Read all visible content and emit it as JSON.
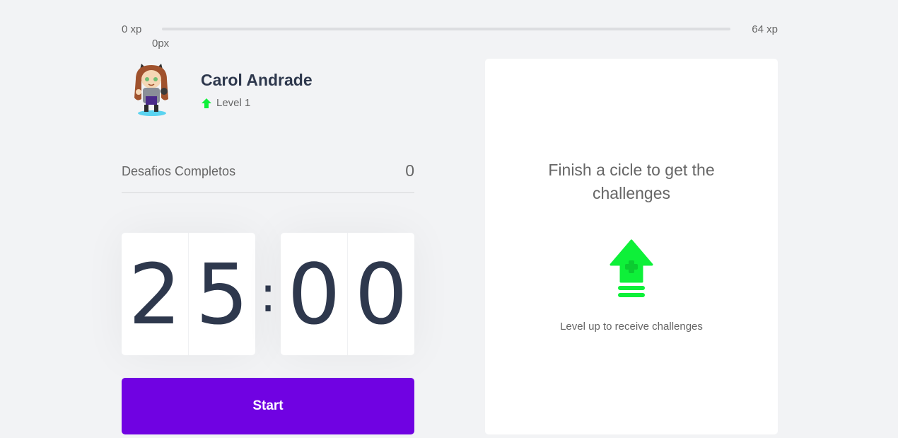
{
  "experience": {
    "min_label": "0 xp",
    "max_label": "64 xp",
    "current_label": "0px",
    "progress": 0
  },
  "profile": {
    "name": "Carol Andrade",
    "level_label": "Level 1",
    "avatar_icon": "avatar-character-icon",
    "level_icon": "level-up-arrow-icon"
  },
  "completed_challenges": {
    "label": "Desafios Completos",
    "count": "0"
  },
  "countdown": {
    "minute_left": "2",
    "minute_right": "5",
    "separator": ":",
    "second_left": "0",
    "second_right": "0"
  },
  "start_button": {
    "label": "Start"
  },
  "challenge_box": {
    "title": "Finish a cicle to get the challenges",
    "hint": "Level up to receive challenges",
    "icon": "level-up-icon"
  },
  "colors": {
    "background": "#f2f3f5",
    "title": "#2e384d",
    "text": "#666666",
    "accent_purple": "#7002e2",
    "level_green": "#0ef039"
  }
}
